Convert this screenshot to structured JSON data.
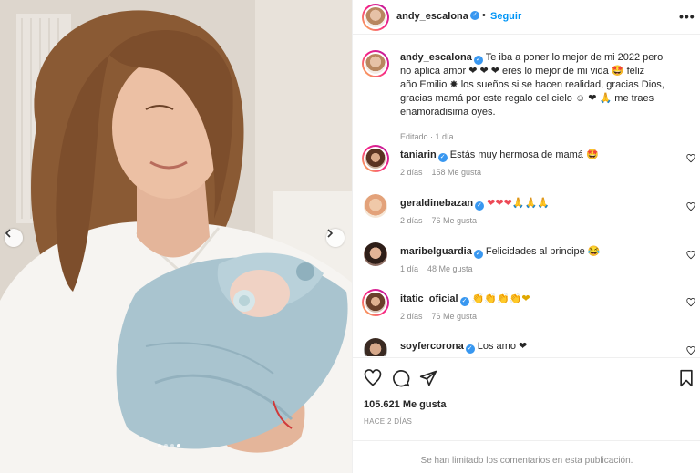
{
  "post": {
    "author": "andy_escalona",
    "follow_label": "Seguir",
    "more_label": "•••",
    "caption": "Te iba a poner lo mejor de mi 2022 pero no aplica amor ❤️❤️❤️ eres lo mejor de mi vida 🤩 feliz año Emilio 🎆 los sueños si se hacen realidad, gracias Dios, gracias mamá por este regalo del cielo 👶❤️🙏 me traes enamoradisima oyes.",
    "caption_lines": [
      "Te iba a poner lo mejor de mi 2022 pero",
      "no aplica amor ❤ ❤ ❤ eres lo mejor de mi vida 🤩 feliz",
      "año Emilio ✸ los sueños si se hacen realidad, gracias Dios,",
      "gracias mamá por este regalo del cielo ☺ ❤ 🙏 me traes",
      "enamoradisima oyes."
    ],
    "edited": "Editado · 1 día"
  },
  "comments": [
    {
      "user": "taniarin",
      "text": "Estás muy hermosa de mamá 🤩",
      "age": "2 días",
      "likes": "158 Me gusta"
    },
    {
      "user": "geraldinebazan",
      "text": "❤❤❤🙏🙏🙏",
      "age": "2 días",
      "likes": "76 Me gusta"
    },
    {
      "user": "maribelguardia",
      "text": "Felicidades al principe 😂",
      "age": "1 día",
      "likes": "48 Me gusta"
    },
    {
      "user": "itatic_oficial",
      "text": "👏👏👏👏❤",
      "age": "2 días",
      "likes": "76 Me gusta"
    },
    {
      "user": "soyfercorona",
      "text": "Los amo ❤",
      "age": "",
      "likes": ""
    }
  ],
  "footer": {
    "likes": "105.621 Me gusta",
    "date": "HACE 2 DÍAS",
    "limited_notice": "Se han limitado los comentarios en esta publicación."
  },
  "carousel": {
    "count": 4,
    "active": 3
  },
  "colors": {
    "link_blue": "#0095f6",
    "verified_blue": "#3897f0",
    "heart_red": "#ed4956",
    "meta_gray": "#8e8e8e"
  },
  "icons": [
    "chevron-left-icon",
    "chevron-right-icon",
    "heart-icon",
    "comment-icon",
    "share-icon",
    "bookmark-icon",
    "verified-icon",
    "more-icon"
  ]
}
